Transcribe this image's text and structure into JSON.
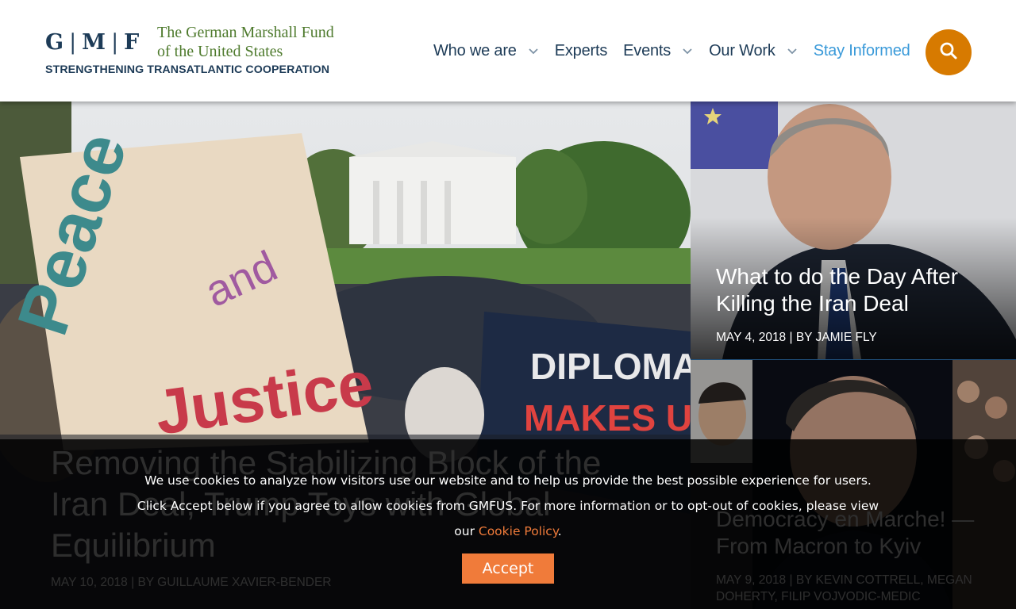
{
  "header": {
    "logo": {
      "mark_letters": [
        "G",
        "M",
        "F"
      ],
      "name_line1": "The German Marshall Fund",
      "name_line2": "of the United States",
      "tagline": "STRENGTHENING TRANSATLANTIC COOPERATION"
    },
    "nav": [
      {
        "label": "Who we are",
        "has_dropdown": true
      },
      {
        "label": "Experts",
        "has_dropdown": false
      },
      {
        "label": "Events",
        "has_dropdown": true
      },
      {
        "label": "Our Work",
        "has_dropdown": true
      },
      {
        "label": "Stay Informed",
        "has_dropdown": false,
        "highlight": true
      }
    ],
    "search_icon": "search-icon"
  },
  "colors": {
    "brand_navy": "#1d3b57",
    "brand_green": "#4f7b2e",
    "nav_highlight": "#3a9ad9",
    "search_button": "#d77a00",
    "cookie_accent": "#f07b3a"
  },
  "features": {
    "main": {
      "title": "Removing the Stabilizing Block of the Iran Deal, Trump Toys with Global Equilibrium",
      "meta": "MAY 10, 2018 | BY GUILLAUME XAVIER-BENDER",
      "image": "protest-white-house-photo"
    },
    "side_top": {
      "title": "What to do the Day After Killing the Iran Deal",
      "meta": "MAY 4, 2018 | BY JAMIE FLY",
      "image": "netanyahu-photo"
    },
    "side_bottom": {
      "title": "Democracy en Marche! — From Macron to Kyiv",
      "meta": "MAY 9, 2018 | BY KEVIN COTTRELL, MEGAN DOHERTY, FILIP VOJVODIC-MEDIC",
      "image": "macron-collage-photo"
    }
  },
  "cookie_banner": {
    "line1": "We use cookies to analyze how visitors use our website and to help us provide the best possible experience for users.",
    "line2": "Click Accept below if you agree to allow cookies from GMFUS. For more information or to opt-out of cookies, please view",
    "line3_prefix": "our ",
    "link_label": "Cookie Policy",
    "line3_suffix": ".",
    "accept_label": "Accept"
  }
}
